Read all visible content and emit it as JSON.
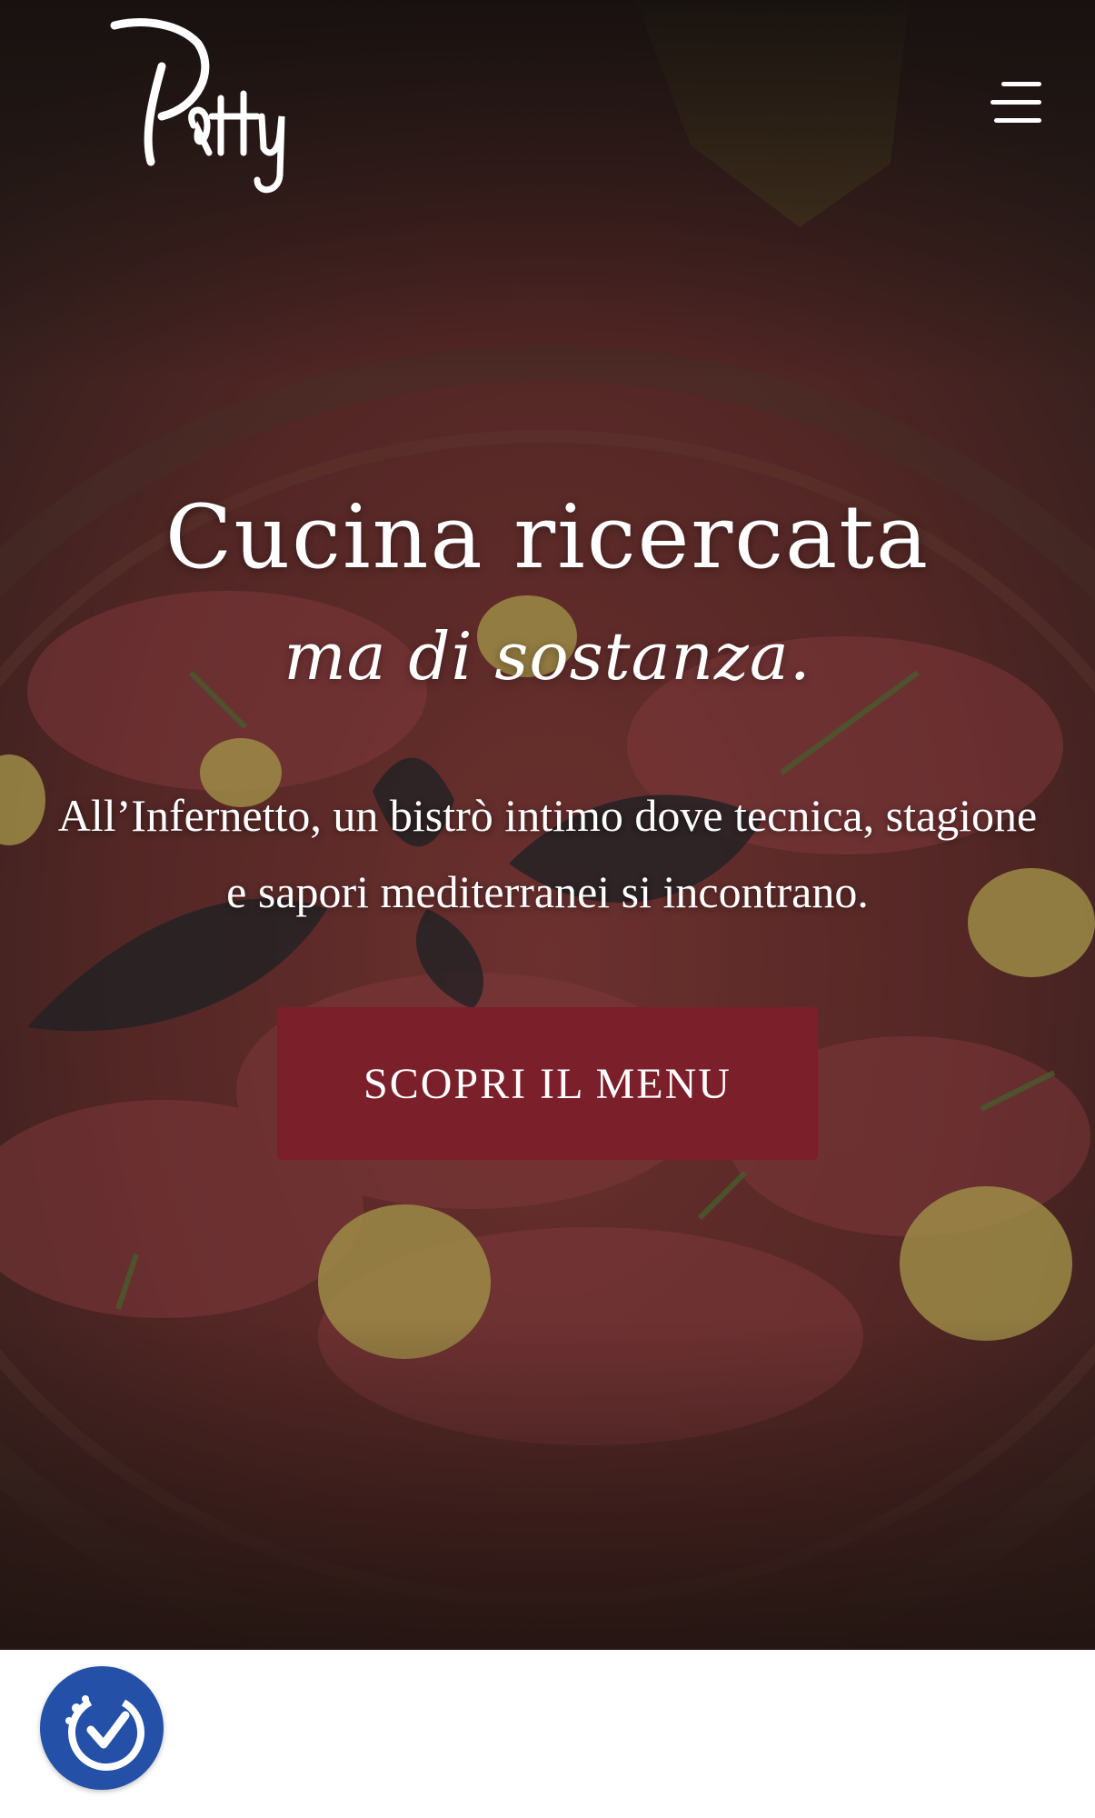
{
  "brand": {
    "logo_text": "Patty"
  },
  "header": {
    "menu_icon": "hamburger-menu-icon"
  },
  "hero": {
    "headline": "Cucina ricercata",
    "script_line": "ma di sostanza.",
    "lead": "All’Infernetto, un bistrò intimo dove tecnica, stagione e sapori mediterranei si incontrano.",
    "cta_label": "SCOPRI IL MENU"
  },
  "accessibility": {
    "icon": "accessibility-check-icon"
  },
  "colors": {
    "cta_background": "#7b1f2a",
    "accessibility_button": "#2450a7",
    "text": "#ffffff"
  }
}
